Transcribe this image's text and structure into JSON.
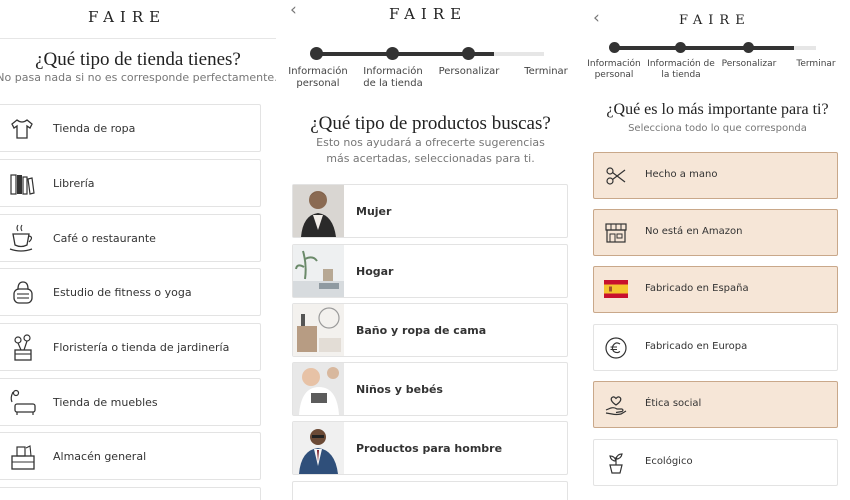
{
  "panel1": {
    "logo": "FAIRE",
    "title": "¿Qué tipo de tienda tienes?",
    "subtitle": "No pasa nada si no es corresponde perfectamente.",
    "items": [
      {
        "label": "Tienda de ropa",
        "icon": "tshirt-icon"
      },
      {
        "label": "Librería",
        "icon": "books-icon"
      },
      {
        "label": "Café o restaurante",
        "icon": "coffee-cup-icon"
      },
      {
        "label": "Estudio de fitness o yoga",
        "icon": "kettlebell-icon"
      },
      {
        "label": "Floristería o tienda de jardinería",
        "icon": "flower-pot-icon"
      },
      {
        "label": "Tienda de muebles",
        "icon": "sofa-lamp-icon"
      },
      {
        "label": "Almacén general",
        "icon": "storage-icon"
      }
    ]
  },
  "panel2": {
    "logo": "FAIRE",
    "back": "‹",
    "steps": [
      {
        "label": "Información personal"
      },
      {
        "label": "Información de la tienda"
      },
      {
        "label": "Personalizar"
      },
      {
        "label": "Terminar"
      }
    ],
    "title": "¿Qué tipo de productos buscas?",
    "subtitle": "Esto nos ayudará a ofrecerte sugerencias más acertadas, seleccionadas para ti.",
    "items": [
      {
        "label": "Mujer",
        "icon": "woman-photo"
      },
      {
        "label": "Hogar",
        "icon": "home-decor-photo"
      },
      {
        "label": "Baño y ropa de cama",
        "icon": "bath-photo"
      },
      {
        "label": "Niños y bebés",
        "icon": "baby-photo"
      },
      {
        "label": "Productos para hombre",
        "icon": "man-photo"
      }
    ]
  },
  "panel3": {
    "logo": "FAIRE",
    "back": "‹",
    "steps": [
      {
        "label": "Información personal"
      },
      {
        "label": "Información de la tienda"
      },
      {
        "label": "Personalizar"
      },
      {
        "label": "Terminar"
      }
    ],
    "title": "¿Qué es lo más importante para ti?",
    "subtitle": "Selecciona todo lo que corresponda",
    "items": [
      {
        "label": "Hecho a mano",
        "icon": "scissors-icon",
        "selected": true
      },
      {
        "label": "No está en Amazon",
        "icon": "storefront-icon",
        "selected": true
      },
      {
        "label": "Fabricado en España",
        "icon": "spain-flag-icon",
        "selected": true
      },
      {
        "label": "Fabricado en Europa",
        "icon": "euro-icon",
        "selected": false
      },
      {
        "label": "Ética social",
        "icon": "heart-hand-icon",
        "selected": true
      },
      {
        "label": "Ecológico",
        "icon": "plant-icon",
        "selected": false
      }
    ]
  },
  "colors": {
    "selected_bg": "#f6e6d7",
    "selected_border": "#c9a88a",
    "progress": "#333333",
    "track": "#e6e6e6"
  }
}
